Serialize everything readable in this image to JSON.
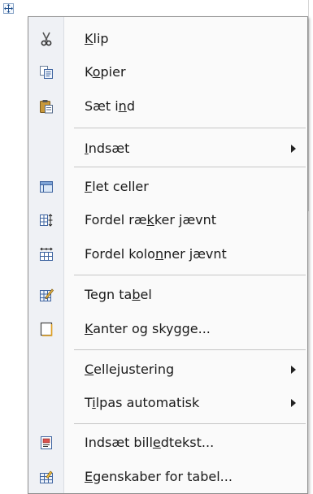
{
  "menu": {
    "items": [
      {
        "pre": "",
        "u": "K",
        "post": "lip",
        "icon": "scissors-icon",
        "submenu": false
      },
      {
        "pre": "K",
        "u": "o",
        "post": "pier",
        "icon": "copy-icon",
        "submenu": false
      },
      {
        "pre": "Sæt i",
        "u": "n",
        "post": "d",
        "icon": "paste-icon",
        "submenu": false
      },
      {
        "pre": "",
        "u": "I",
        "post": "ndsæt",
        "icon": "",
        "submenu": true
      },
      {
        "pre": "",
        "u": "F",
        "post": "let celler",
        "icon": "merge-cells-icon",
        "submenu": false
      },
      {
        "pre": "Fordel ræ",
        "u": "k",
        "post": "ker jævnt",
        "icon": "distribute-rows-icon",
        "submenu": false
      },
      {
        "pre": "Fordel kolo",
        "u": "n",
        "post": "ner jævnt",
        "icon": "distribute-columns-icon",
        "submenu": false
      },
      {
        "pre": "Tegn ta",
        "u": "b",
        "post": "el",
        "icon": "draw-table-icon",
        "submenu": false
      },
      {
        "pre": "",
        "u": "K",
        "post": "anter og skygge...",
        "icon": "borders-shading-icon",
        "submenu": false
      },
      {
        "pre": "",
        "u": "C",
        "post": "ellejustering",
        "icon": "",
        "submenu": true
      },
      {
        "pre": "T",
        "u": "i",
        "post": "lpas automatisk",
        "icon": "",
        "submenu": true
      },
      {
        "pre": "Indsæt bill",
        "u": "e",
        "post": "dtekst...",
        "icon": "insert-caption-icon",
        "submenu": false
      },
      {
        "pre": "",
        "u": "E",
        "post": "genskaber for tabel...",
        "icon": "table-properties-icon",
        "submenu": false
      }
    ]
  }
}
